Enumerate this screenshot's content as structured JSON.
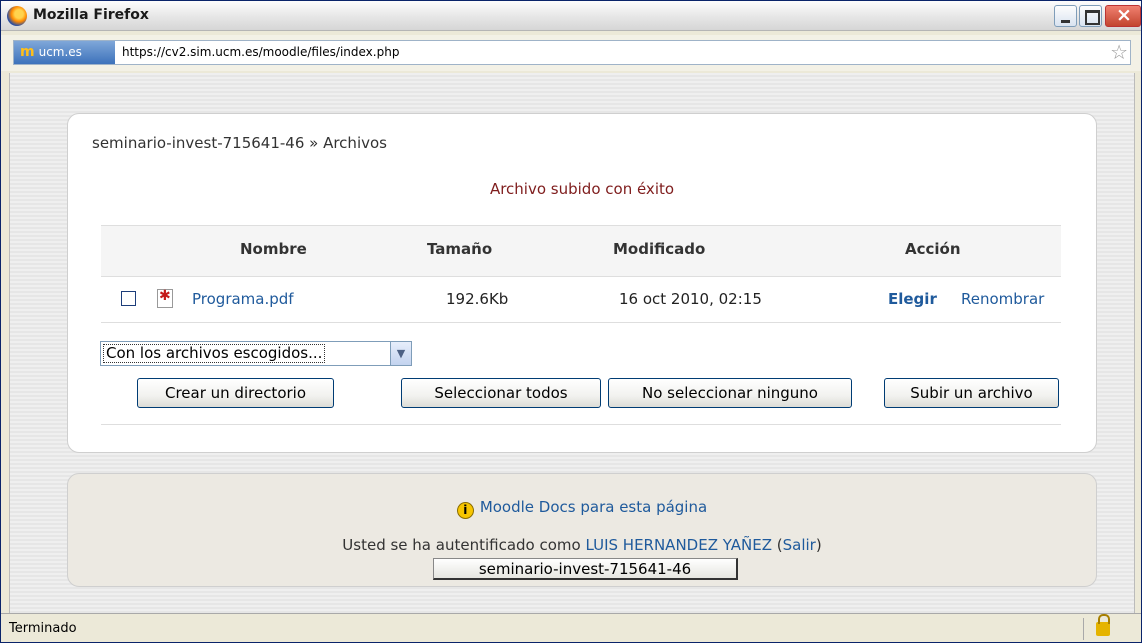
{
  "window": {
    "title": "Mozilla Firefox"
  },
  "urlbar": {
    "site_label": "ucm.es",
    "site_logo": "m",
    "url": "https://cv2.sim.ucm.es/moodle/files/index.php"
  },
  "page": {
    "breadcrumb": "seminario-invest-715641-46 » Archivos",
    "success_message": "Archivo subido con éxito",
    "table": {
      "headers": {
        "name": "Nombre",
        "size": "Tamaño",
        "modified": "Modificado",
        "action": "Acción"
      },
      "rows": [
        {
          "name": "Programa.pdf",
          "size": "192.6Kb",
          "modified": "16 oct 2010, 02:15",
          "action_choose": "Elegir",
          "action_rename": "Renombrar"
        }
      ]
    },
    "selection_dropdown": "Con los archivos escogidos...",
    "buttons": {
      "create_dir": "Crear un directorio",
      "select_all": "Seleccionar todos",
      "select_none": "No seleccionar ninguno",
      "upload": "Subir un archivo"
    }
  },
  "footer": {
    "docs_link": "Moodle Docs para esta página",
    "logged_prefix": "Usted se ha autentificado como",
    "user_name": "LUIS HERNANDEZ YAÑEZ",
    "logout_open": "(",
    "logout": "Salir",
    "logout_close": ")",
    "course_button": "seminario-invest-715641-46"
  },
  "statusbar": {
    "text": "Terminado"
  }
}
